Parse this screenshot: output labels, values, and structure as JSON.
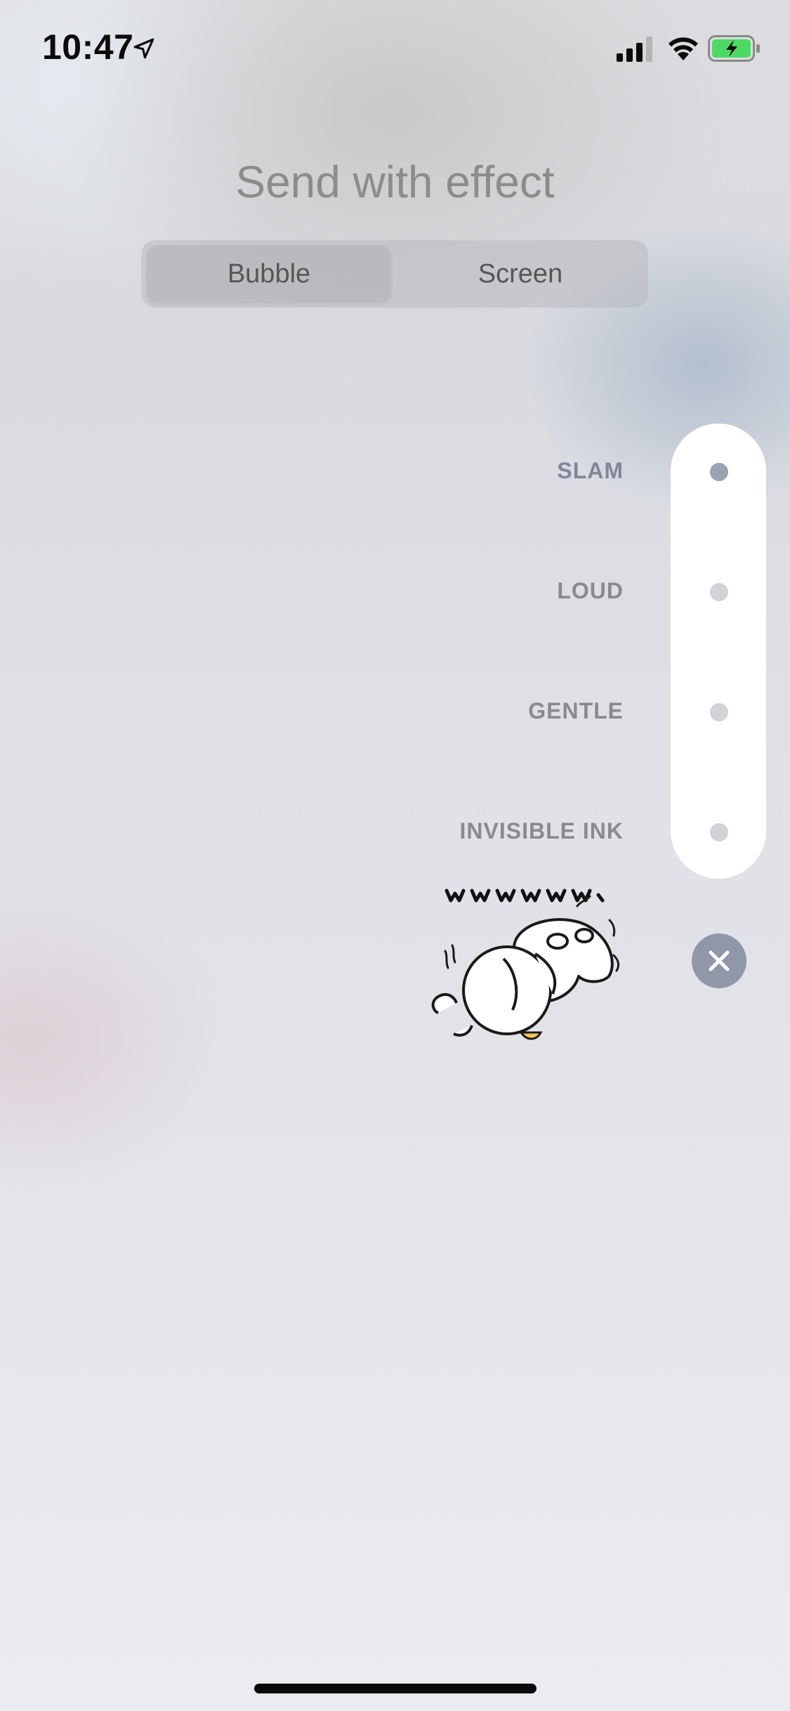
{
  "status_bar": {
    "time": "10:47",
    "icons": [
      "location-arrow-icon",
      "cellular-signal-icon",
      "wifi-icon",
      "battery-charging-icon"
    ],
    "battery_color": "#4cd964"
  },
  "header": {
    "title": "Send with effect"
  },
  "segmented_control": {
    "selected": "Bubble",
    "tabs": [
      {
        "label": "Bubble"
      },
      {
        "label": "Screen"
      }
    ]
  },
  "effects": {
    "selected": "SLAM",
    "items": [
      {
        "label": "SLAM"
      },
      {
        "label": "LOUD"
      },
      {
        "label": "GENTLE"
      },
      {
        "label": "INVISIBLE INK"
      }
    ]
  },
  "message": {
    "type": "sticker",
    "sticker_icon": "crying-bear-sticker-icon",
    "sticker_text": "wwwwww"
  },
  "close_button": {
    "icon": "close-icon"
  },
  "colors": {
    "title": "#8c8c8c",
    "selected_dot": "#9aa1af",
    "dot": "#d2d3d8",
    "close_button": "#9097a8"
  }
}
